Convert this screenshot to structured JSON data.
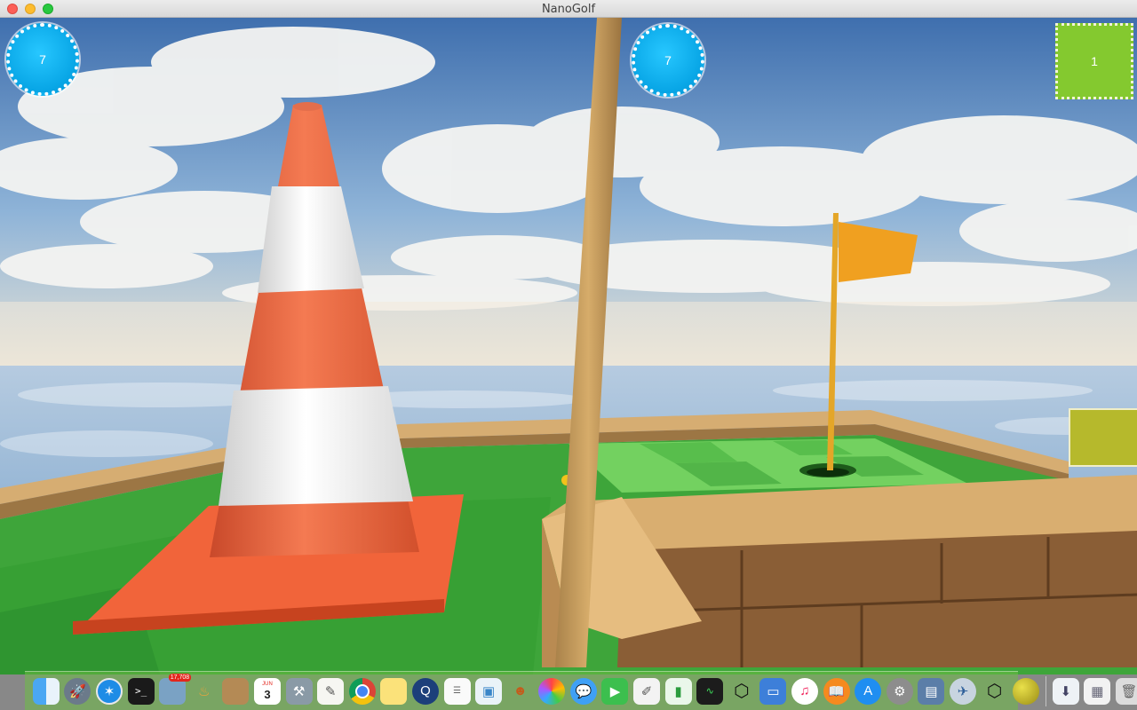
{
  "window": {
    "title": "NanoGolf"
  },
  "hud": {
    "left_counter": "7",
    "center_counter": "7",
    "right_panel": "1"
  },
  "colors": {
    "hud_circle": "#08a6e6",
    "hud_box": "#84c92f",
    "cone_orange": "#f0643c",
    "grass": "#3ea53a",
    "flag": "#f0a020"
  },
  "dock": {
    "calendar_day": "3",
    "calendar_month": "JUN",
    "badge_count": "17,708",
    "items": [
      "finder-icon",
      "launchpad-icon",
      "safari-icon",
      "terminal-icon",
      "preview-icon",
      "lamp-icon",
      "archive-icon",
      "calendar-icon",
      "instruments-icon",
      "textedit-icon",
      "chrome-icon",
      "notes-icon",
      "quicktime-icon",
      "reminders-icon",
      "photo-icon",
      "mascot-icon",
      "photos-icon",
      "messages-icon",
      "facetime-icon",
      "editor-icon",
      "numbers-icon",
      "activity-monitor-icon",
      "unity-icon",
      "keynote-icon",
      "music-icon",
      "books-icon",
      "app-store-icon",
      "system-preferences-icon",
      "image-capture-icon",
      "safari-alt-icon",
      "unity-alt-icon",
      "golf-ball-icon",
      "downloads-icon",
      "documents-icon",
      "trash-icon"
    ]
  }
}
